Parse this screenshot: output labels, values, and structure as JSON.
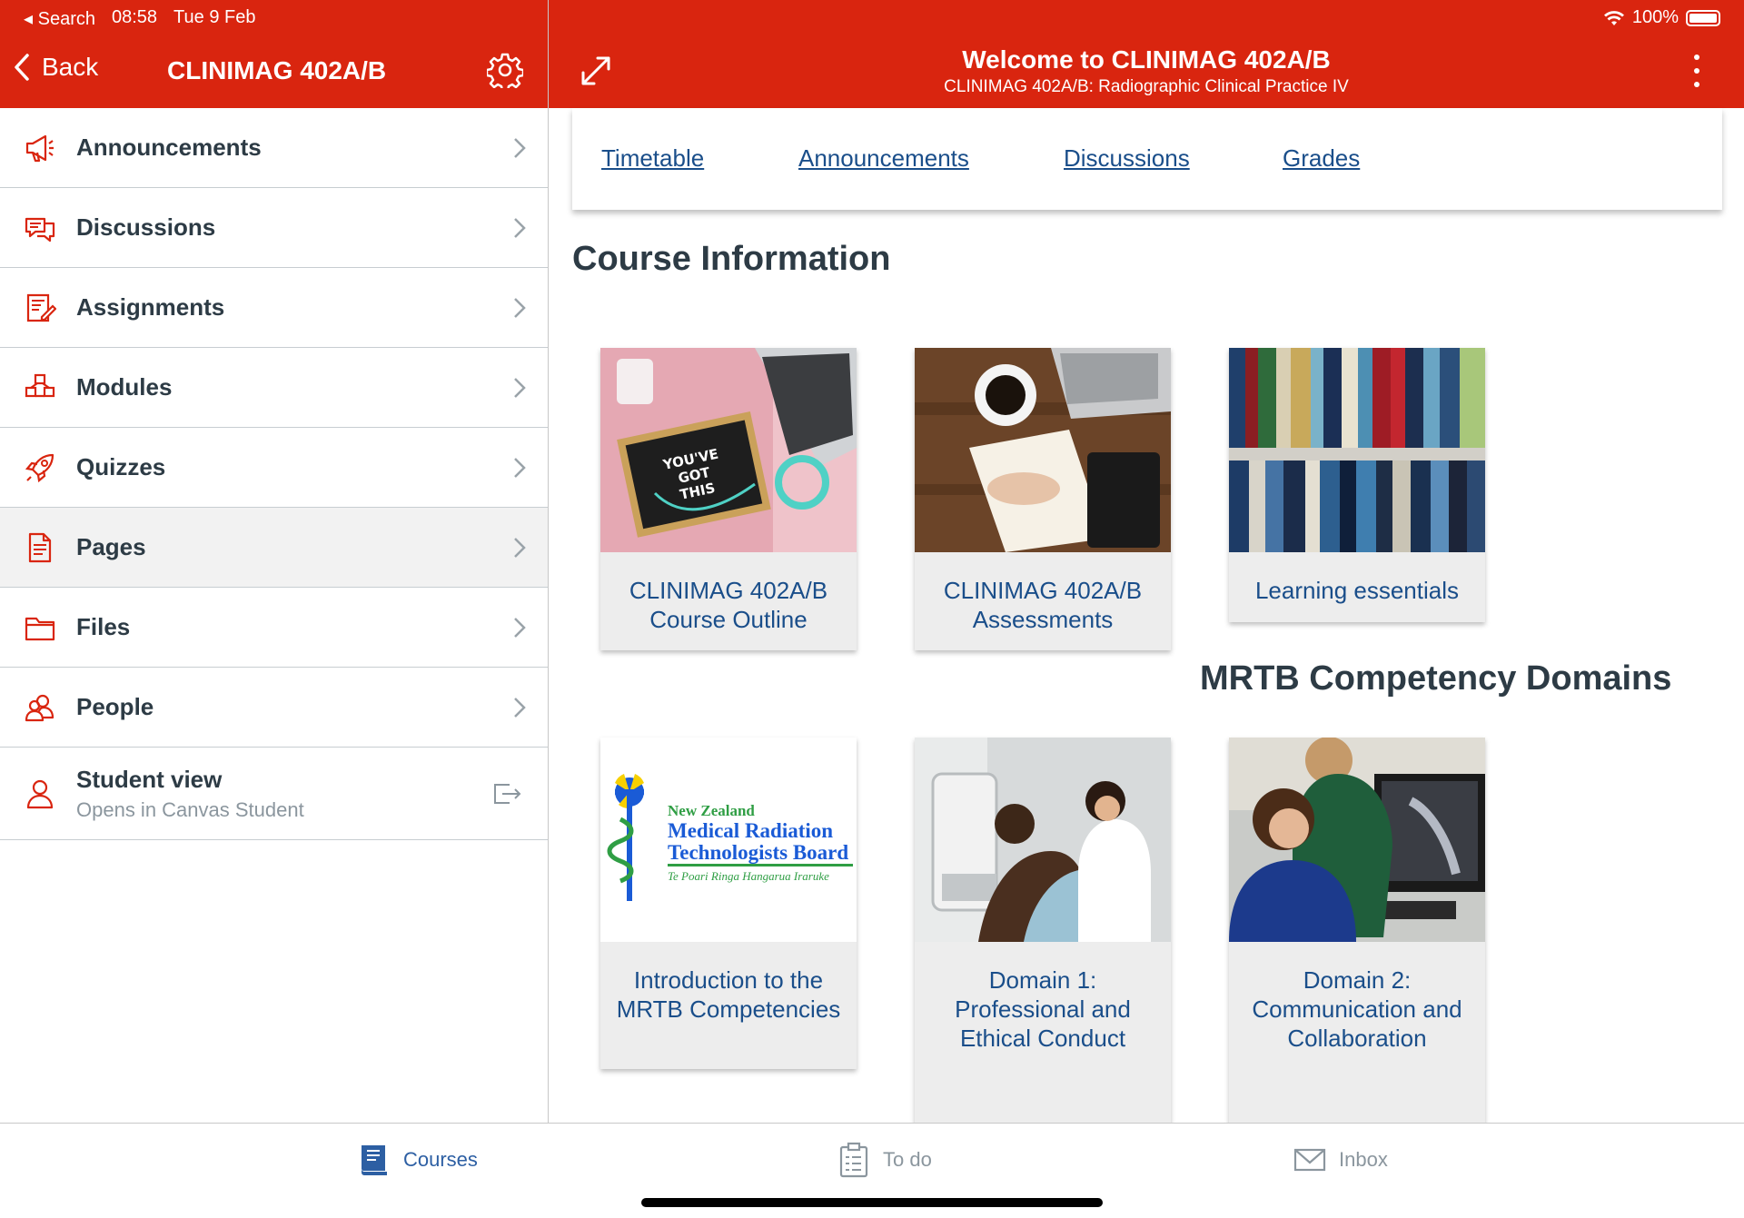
{
  "status_bar": {
    "back_app": "Search",
    "time": "08:58",
    "date": "Tue 9 Feb",
    "battery": "100%"
  },
  "left_header": {
    "back_label": "Back",
    "course_title": "CLINIMAG 402A/B"
  },
  "right_header": {
    "title": "Welcome to CLINIMAG 402A/B",
    "subtitle": "CLINIMAG 402A/B: Radiographic Clinical Practice IV"
  },
  "sidebar": {
    "items": [
      {
        "label": "Announcements",
        "icon": "megaphone-icon"
      },
      {
        "label": "Discussions",
        "icon": "discussions-icon"
      },
      {
        "label": "Assignments",
        "icon": "assignments-icon"
      },
      {
        "label": "Modules",
        "icon": "modules-icon"
      },
      {
        "label": "Quizzes",
        "icon": "rocket-icon"
      },
      {
        "label": "Pages",
        "icon": "document-icon"
      },
      {
        "label": "Files",
        "icon": "folder-icon"
      },
      {
        "label": "People",
        "icon": "people-icon"
      }
    ],
    "student_view": {
      "label": "Student view",
      "sub": "Opens in Canvas Student"
    }
  },
  "content_nav": {
    "links": [
      "Timetable",
      "Announcements",
      "Discussions",
      "Grades"
    ]
  },
  "course_info": {
    "title": "Course Information",
    "tiles": [
      {
        "label": "CLINIMAG 402A/B Course Outline",
        "letterboard": [
          "YOU'VE",
          "GOT",
          "THIS"
        ]
      },
      {
        "label": "CLINIMAG 402A/B Assessments"
      },
      {
        "label": "Learning essentials"
      }
    ]
  },
  "mrtb": {
    "title": "MRTB Competency Domains",
    "logo": {
      "line1": "New Zealand",
      "line2": "Medical Radiation",
      "line3": "Technologists Board",
      "line4": "Te Poari Ringa Hangarua Iraruke"
    },
    "tiles": [
      {
        "label": "Introduction to the MRTB Competencies"
      },
      {
        "label": "Domain 1: Professional and Ethical Conduct"
      },
      {
        "label": "Domain 2: Communication and Collaboration"
      }
    ]
  },
  "tabbar": {
    "tabs": [
      "Courses",
      "To do",
      "Inbox"
    ]
  },
  "colors": {
    "brand_red": "#d9250f",
    "link_blue": "#1a4e8a",
    "active_tab": "#2d5fa3",
    "inactive_tab": "#8b969e"
  }
}
